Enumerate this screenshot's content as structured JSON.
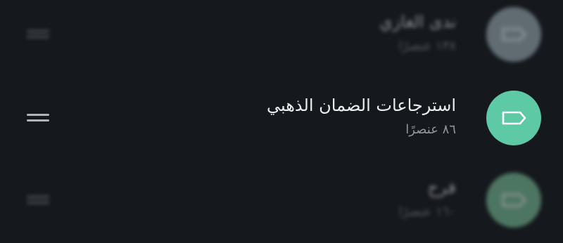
{
  "lists": [
    {
      "name": "ندى الغازي",
      "count": "١٣٨ عنصرًا",
      "avatar_color": "#9fb2b9",
      "icon": "tag-icon",
      "dimmed": true
    },
    {
      "name": "استرجاعات الضمان الذهبي",
      "count": "٨٦ عنصرًا",
      "avatar_color": "#5ec9a5",
      "icon": "tag-icon",
      "dimmed": false
    },
    {
      "name": "فرح",
      "count": "١٦٠ عنصرًا",
      "avatar_color": "#7cc49b",
      "icon": "tag-icon",
      "dimmed": true
    }
  ],
  "colors": {
    "background": "#15181d",
    "title_text": "#e9edef",
    "subtitle_text": "#8d969d",
    "drag_handle": "#aeb4b8"
  }
}
